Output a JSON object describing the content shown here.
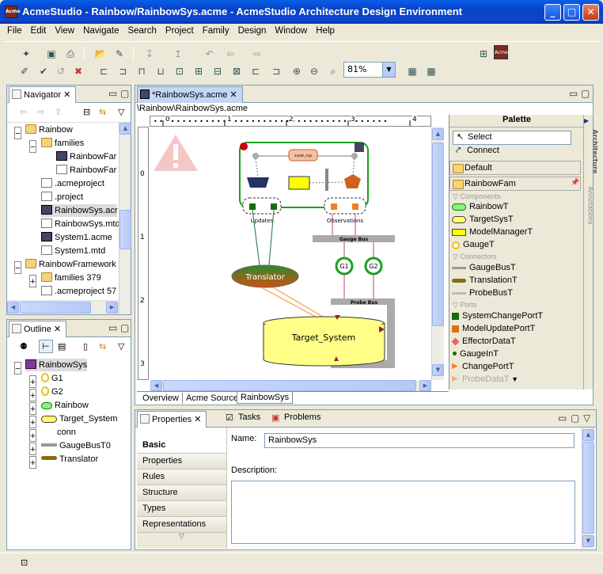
{
  "window": {
    "title": "AcmeStudio - Rainbow/RainbowSys.acme - AcmeStudio Architecture Design Environment",
    "app_icon": "Acme",
    "minimize": "_",
    "maximize": "□",
    "close": "✕"
  },
  "menu": [
    "File",
    "Edit",
    "View",
    "Navigate",
    "Search",
    "Project",
    "Family",
    "Design",
    "Window",
    "Help"
  ],
  "toolbar": {
    "zoom": "81%"
  },
  "navigator": {
    "title": "Navigator",
    "items": [
      {
        "label": "Rainbow",
        "icon": "project-folder"
      },
      {
        "label": "families",
        "icon": "folder"
      },
      {
        "label": "RainbowFar",
        "icon": "acme-file"
      },
      {
        "label": "RainbowFar",
        "icon": "document"
      },
      {
        "label": ".acmeproject",
        "icon": "document"
      },
      {
        "label": ".project",
        "icon": "document"
      },
      {
        "label": "RainbowSys.acr",
        "icon": "acme-file"
      },
      {
        "label": "RainbowSys.mtd",
        "icon": "document"
      },
      {
        "label": "System1.acme",
        "icon": "acme-file"
      },
      {
        "label": "System1.mtd",
        "icon": "document"
      },
      {
        "label": "RainbowFramework",
        "icon": "project-folder"
      },
      {
        "label": "families 379",
        "icon": "folder"
      },
      {
        "label": ".acmeproject 57",
        "icon": "document"
      }
    ]
  },
  "outline": {
    "title": "Outline",
    "items": [
      {
        "label": "RainbowSys",
        "icon": "system"
      },
      {
        "label": "G1",
        "icon": "gauge"
      },
      {
        "label": "G2",
        "icon": "gauge"
      },
      {
        "label": "Rainbow",
        "icon": "rainbow-component"
      },
      {
        "label": "Target_System",
        "icon": "target-system"
      },
      {
        "label": "conn",
        "icon": "connector"
      },
      {
        "label": "GaugeBusT0",
        "icon": "gauge-bus"
      },
      {
        "label": "Translator",
        "icon": "translation"
      }
    ]
  },
  "editor": {
    "tab": "*RainbowSys.acme",
    "breadcrumb": "\\Rainbow\\RainbowSys.acme",
    "ruler_ticks": [
      "0",
      "1",
      "2",
      "3",
      "4"
    ],
    "vruler_ticks": [
      "0",
      "1",
      "2",
      "3"
    ],
    "bottom_tabs": [
      "Overview",
      "Acme Source",
      "RainbowSys"
    ],
    "diagram": {
      "updates": "Updates",
      "observations": "Observations",
      "gauge_bus": "Gauge Bus",
      "probe_bus": "Probe Bus",
      "translator": "Translator",
      "target": "Target_System",
      "g1": "G1",
      "g2": "G2",
      "inner_label": "model_mgr"
    }
  },
  "palette": {
    "title": "Palette",
    "tools": [
      "Select",
      "Connect"
    ],
    "drawers": [
      "Default",
      "RainbowFam"
    ],
    "sections": [
      {
        "name": "Components",
        "items": [
          "RainbowT",
          "TargetSysT",
          "ModelManagerT",
          "GaugeT"
        ]
      },
      {
        "name": "Connectors",
        "items": [
          "GaugeBusT",
          "TranslationT",
          "ProbeBusT"
        ]
      },
      {
        "name": "Ports",
        "items": [
          "SystemChangePortT",
          "ModelUpdatePortT",
          "EffectorDataT",
          "GaugeInT",
          "ChangePortT",
          "ProbeDataT"
        ]
      }
    ],
    "side_tabs": [
      "Architecture",
      "Annotations"
    ]
  },
  "properties": {
    "tabs": [
      "Properties",
      "Tasks",
      "Problems"
    ],
    "categories": [
      "Basic",
      "Properties",
      "Rules",
      "Structure",
      "Types",
      "Representations"
    ],
    "name_label": "Name:",
    "name_value": "RainbowSys",
    "description_label": "Description:",
    "description_value": ""
  }
}
